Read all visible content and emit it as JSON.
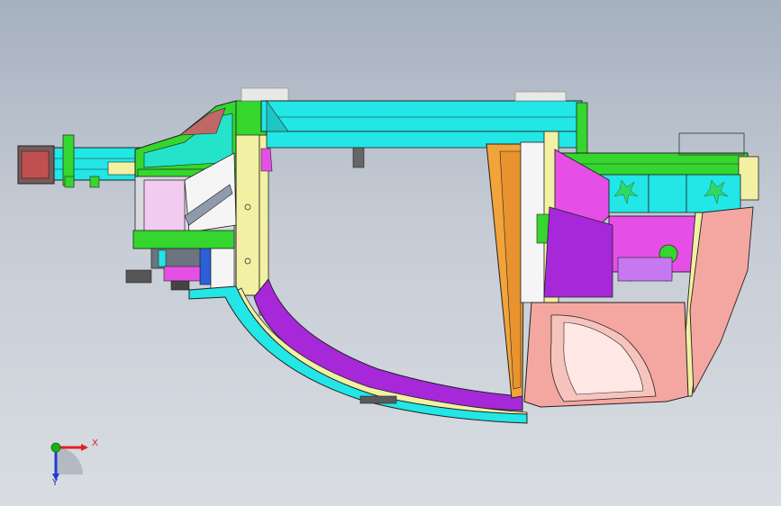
{
  "triad": {
    "x_label": "X",
    "y_label": "Y",
    "x_color": "#e02020",
    "y_color": "#1e3fd0",
    "origin_color": "#18b018"
  },
  "model": {
    "colors": {
      "cyan": "#23e6e6",
      "green": "#35d62e",
      "yellow": "#f2f0a2",
      "magenta": "#e64fe6",
      "purple": "#a628d9",
      "orange": "#f2a33a",
      "pink": "#f4a7a0",
      "light_pink": "#f2cbf0",
      "white": "#f5f5f5",
      "grey": "#8f9bab",
      "dark": "#4a4a4a"
    }
  }
}
